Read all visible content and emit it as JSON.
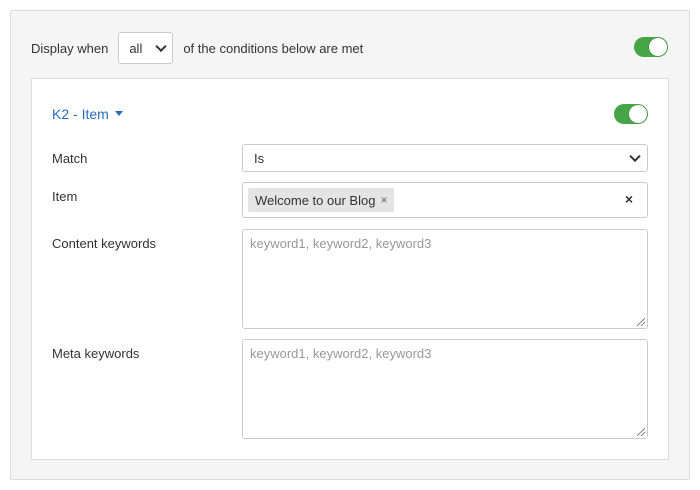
{
  "condition": {
    "prefix": "Display when",
    "match_select_value": "all",
    "suffix": "of the conditions below are met",
    "toggle_on": true
  },
  "group": {
    "title": "K2 - Item",
    "toggle_on": true,
    "fields": {
      "match": {
        "label": "Match",
        "value": "Is"
      },
      "item": {
        "label": "Item",
        "tags": [
          "Welcome to our Blog"
        ],
        "tag_remove": "×",
        "clear": "×"
      },
      "content_keywords": {
        "label": "Content keywords",
        "placeholder": "keyword1, keyword2, keyword3"
      },
      "meta_keywords": {
        "label": "Meta keywords",
        "placeholder": "keyword1, keyword2, keyword3"
      }
    }
  },
  "colors": {
    "toggle_on": "#46a546",
    "link": "#2a6ebb"
  }
}
